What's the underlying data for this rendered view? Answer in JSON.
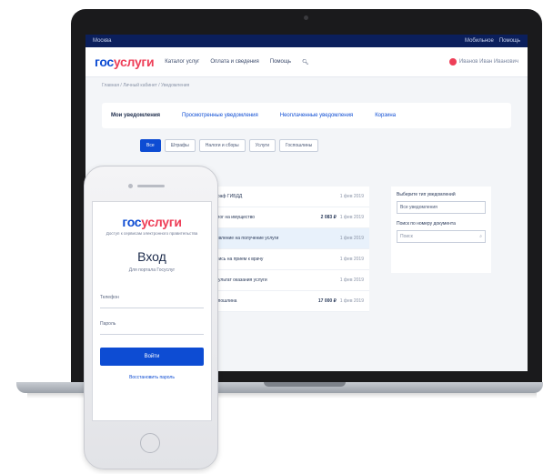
{
  "topbar": {
    "region": "Москва",
    "right1": "Мобильное",
    "right2": "Помощь"
  },
  "header": {
    "logo_a": "гос",
    "logo_b": "услуги",
    "nav": [
      "Каталог услуг",
      "Оплата и сведения",
      "Помощь"
    ],
    "profile": "Иванов Иван Иванович"
  },
  "breadcrumb": "Главная  /  Личный кабинет  /  Уведомления",
  "tabs": [
    "Мои уведомления",
    "Просмотренные уведомления",
    "Неоплаченные уведомления",
    "Корзина"
  ],
  "filters": [
    "Все",
    "Штрафы",
    "Налоги и сборы",
    "Услуги",
    "Госпошлины"
  ],
  "list": [
    {
      "title": "Штраф ГИБДД",
      "meta": "1 фев 2019",
      "sum": ""
    },
    {
      "title": "Налог на имущество",
      "meta": "1 фев 2019",
      "sum": "2 083 ₽"
    },
    {
      "title": "Заявление на получение услуги",
      "meta": "1 фев 2019",
      "sum": ""
    },
    {
      "title": "Запись на прием к врачу",
      "meta": "1 фев 2019",
      "sum": ""
    },
    {
      "title": "Результат оказания услуги",
      "meta": "1 фев 2019",
      "sum": ""
    },
    {
      "title": "Госпошлина",
      "meta": "1 фев 2019",
      "sum": "17 000 ₽"
    }
  ],
  "side": {
    "label1": "Выберите тип уведомлений",
    "select1": "Все уведомления",
    "label2": "Поиск по номеру документа",
    "input_placeholder": "Поиск"
  },
  "phone": {
    "logo_a": "гос",
    "logo_b": "услуги",
    "subtitle": "Доступ к сервисам электронного правительства",
    "title": "Вход",
    "tip": "Для портала Госуслуг",
    "field1": "Телефон",
    "field2": "Пароль",
    "button": "Войти",
    "link": "Восстановить пароль"
  },
  "colors": {
    "brand_blue": "#0d4cd3",
    "brand_red": "#ee3f58",
    "topbar": "#0b1f5c"
  }
}
